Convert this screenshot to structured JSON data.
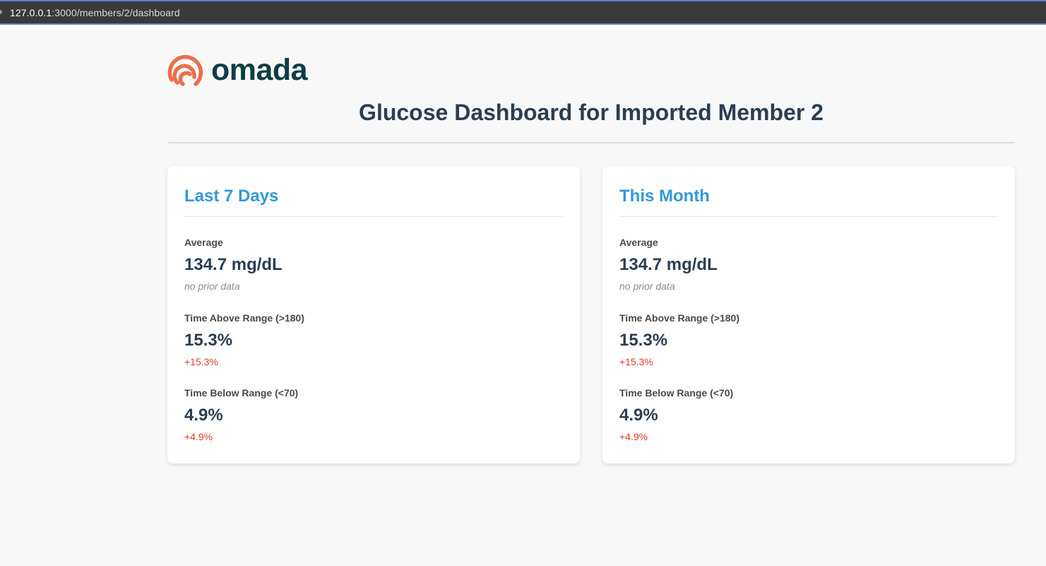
{
  "browser": {
    "url_host": "127.0.0.1",
    "url_rest": ":3000/members/2/dashboard"
  },
  "brand": {
    "logo_text": "omada",
    "logo_color": "#0e3e45",
    "mark_color": "#e8714a"
  },
  "page": {
    "title": "Glucose Dashboard for Imported Member 2"
  },
  "cards": [
    {
      "title": "Last 7 Days",
      "metrics": [
        {
          "label": "Average",
          "value": "134.7 mg/dL",
          "change": "no prior data"
        },
        {
          "label": "Time Above Range (>180)",
          "value": "15.3%",
          "change": "+15.3%"
        },
        {
          "label": "Time Below Range (<70)",
          "value": "4.9%",
          "change": "+4.9%"
        }
      ]
    },
    {
      "title": "This Month",
      "metrics": [
        {
          "label": "Average",
          "value": "134.7 mg/dL",
          "change": "no prior data"
        },
        {
          "label": "Time Above Range (>180)",
          "value": "15.3%",
          "change": "+15.3%"
        },
        {
          "label": "Time Below Range (<70)",
          "value": "4.9%",
          "change": "+4.9%"
        }
      ]
    }
  ],
  "colors": {
    "accent": "#3498db",
    "increase": "#e03b2c",
    "muted": "#8a8a8a"
  }
}
